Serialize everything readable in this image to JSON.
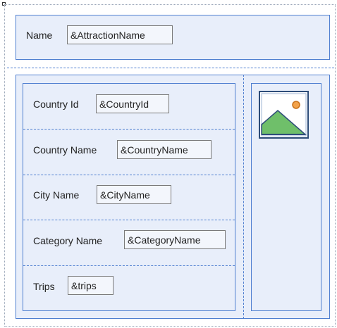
{
  "header": {
    "label": "Name",
    "variable": "&AttractionName"
  },
  "rows": [
    {
      "label": "Country Id",
      "variable": "&CountryId"
    },
    {
      "label": "Country Name",
      "variable": "&CountryName"
    },
    {
      "label": "City Name",
      "variable": "&CityName"
    },
    {
      "label": "Category Name",
      "variable": "&CategoryName"
    },
    {
      "label": "Trips",
      "variable": "&trips"
    }
  ],
  "image": {
    "icon": "image-placeholder-icon"
  }
}
